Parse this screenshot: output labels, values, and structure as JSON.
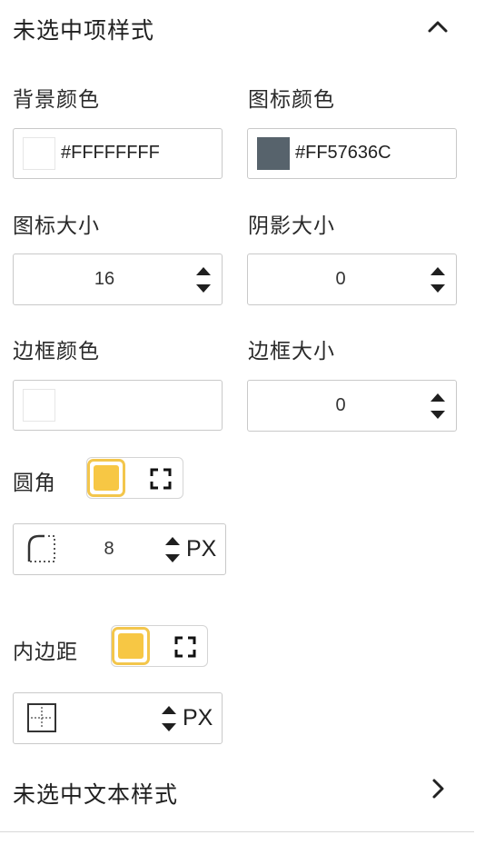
{
  "section_unselected_style": {
    "title": "未选中项样式"
  },
  "background_color": {
    "label": "背景颜色",
    "value": "#FFFFFFFF",
    "swatch": "#FFFFFF"
  },
  "icon_color": {
    "label": "图标颜色",
    "value": "#FF57636C",
    "swatch": "#57636C"
  },
  "icon_size": {
    "label": "图标大小",
    "value": "16"
  },
  "shadow_size": {
    "label": "阴影大小",
    "value": "0"
  },
  "border_color": {
    "label": "边框颜色",
    "value": "",
    "swatch": "#FFFFFF"
  },
  "border_size": {
    "label": "边框大小",
    "value": "0"
  },
  "corner_radius": {
    "label": "圆角",
    "value": "8",
    "unit": "PX"
  },
  "padding": {
    "label": "内边距",
    "value": "",
    "unit": "PX"
  },
  "section_unselected_text_style": {
    "title": "未选中文本样式"
  },
  "colors": {
    "accent": "#F7C744",
    "border": "#C9C9C9"
  }
}
